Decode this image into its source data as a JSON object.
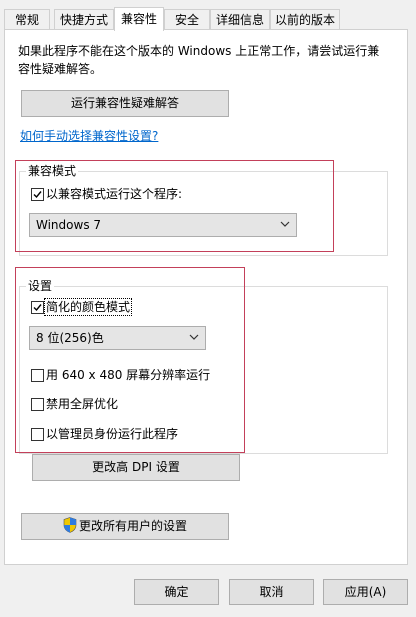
{
  "tabs": [
    {
      "label": "常规"
    },
    {
      "label": "快捷方式"
    },
    {
      "label": "兼容性"
    },
    {
      "label": "安全"
    },
    {
      "label": "详细信息"
    },
    {
      "label": "以前的版本"
    }
  ],
  "active_tab": "兼容性",
  "description": "如果此程序不能在这个版本的 Windows 上正常工作，请尝试运行兼容性疑难解答。",
  "troubleshooter_button": "运行兼容性疑难解答",
  "manual_link": "如何手动选择兼容性设置?",
  "compat_mode": {
    "group_title": "兼容模式",
    "checkbox_label": "以兼容模式运行这个程序:",
    "checked": true,
    "selected_os": "Windows 7"
  },
  "settings": {
    "group_title": "设置",
    "reduced_color": {
      "label": "简化的颜色模式",
      "checked": true
    },
    "color_depth": "8 位(256)色",
    "run_640": {
      "label": "用 640 x 480 屏幕分辨率运行",
      "checked": false
    },
    "disable_fullscreen": {
      "label": "禁用全屏优化",
      "checked": false
    },
    "run_as_admin": {
      "label": "以管理员身份运行此程序",
      "checked": false
    },
    "dpi_button": "更改高 DPI 设置"
  },
  "all_users_button": "更改所有用户的设置",
  "footer": {
    "ok": "确定",
    "cancel": "取消",
    "apply": "应用(A)"
  },
  "colors": {
    "highlight_frame": "#c3405a",
    "link": "#0066cc",
    "default_button_border": "#0078d7"
  },
  "icons": {
    "shield": "uac-shield-icon",
    "checkmark": "checkmark-icon",
    "dropdown": "chevron-down-icon"
  }
}
